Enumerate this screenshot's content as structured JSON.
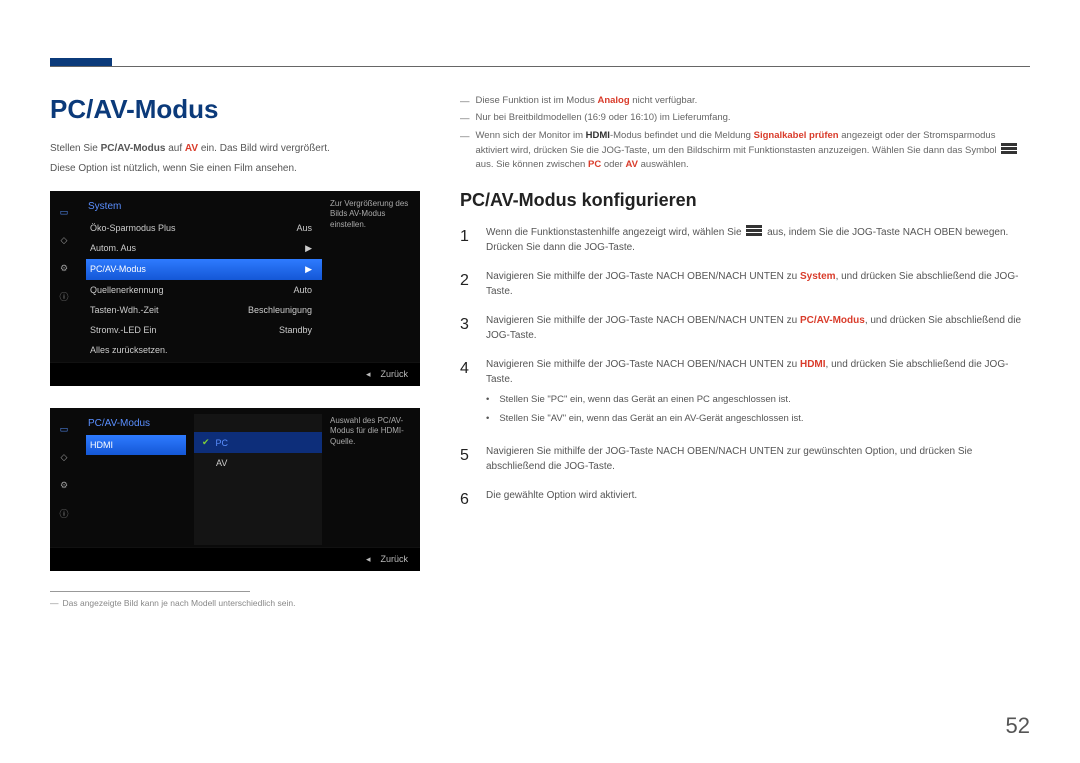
{
  "page_number": "52",
  "left": {
    "title": "PC/AV-Modus",
    "intro1_pre": "Stellen Sie ",
    "intro1_b1": "PC/AV-Modus",
    "intro1_mid": " auf ",
    "intro1_b2": "AV",
    "intro1_post": " ein. Das Bild wird vergrößert.",
    "intro2": "Diese Option ist nützlich, wenn Sie einen Film ansehen.",
    "osd1": {
      "title": "System",
      "rows": [
        {
          "label": "Öko-Sparmodus Plus",
          "value": "Aus"
        },
        {
          "label": "Autom. Aus",
          "value": "▶"
        },
        {
          "label": "PC/AV-Modus",
          "value": "▶",
          "hl": true
        },
        {
          "label": "Quellenerkennung",
          "value": "Auto"
        },
        {
          "label": "Tasten-Wdh.-Zeit",
          "value": "Beschleunigung"
        },
        {
          "label": "Stromv.-LED Ein",
          "value": "Standby"
        },
        {
          "label": "Alles zurücksetzen.",
          "value": ""
        }
      ],
      "desc": "Zur Vergrößerung des Bilds AV-Modus einstellen.",
      "footer": "Zurück"
    },
    "osd2": {
      "title": "PC/AV-Modus",
      "row_label": "HDMI",
      "sub": [
        {
          "label": "PC",
          "on": true
        },
        {
          "label": "AV",
          "on": false
        }
      ],
      "desc": "Auswahl des PC/AV-Modus für die HDMI-Quelle.",
      "footer": "Zurück"
    },
    "footnote": "Das angezeigte Bild kann je nach Modell unterschiedlich sein."
  },
  "right": {
    "notes": {
      "n1_pre": "Diese Funktion ist im Modus ",
      "n1_b": "Analog",
      "n1_post": " nicht verfügbar.",
      "n2": "Nur bei Breitbildmodellen (16:9 oder 16:10) im Lieferumfang.",
      "n3_pre": "Wenn sich der Monitor im ",
      "n3_b1": "HDMI",
      "n3_mid1": "-Modus befindet und die Meldung ",
      "n3_b2": "Signalkabel prüfen",
      "n3_mid2": " angezeigt oder der Stromsparmodus aktiviert wird, drücken Sie die JOG-Taste, um den Bildschirm mit Funktionstasten anzuzeigen. Wählen Sie dann das Symbol ",
      "n3_mid3": " aus. Sie können zwischen ",
      "n3_b3": "PC",
      "n3_or": " oder ",
      "n3_b4": "AV",
      "n3_post": " auswählen."
    },
    "h2": "PC/AV-Modus konfigurieren",
    "steps": {
      "s1a": "Wenn die Funktionstastenhilfe angezeigt wird, wählen Sie ",
      "s1b": " aus, indem Sie die JOG-Taste NACH OBEN bewegen.",
      "s1c": "Drücken Sie dann die JOG-Taste.",
      "s2a": "Navigieren Sie mithilfe der JOG-Taste NACH OBEN/NACH UNTEN zu ",
      "s2b": "System",
      "s2c": ", und drücken Sie abschließend die JOG-Taste.",
      "s3a": "Navigieren Sie mithilfe der JOG-Taste NACH OBEN/NACH UNTEN zu ",
      "s3b": "PC/AV-Modus",
      "s3c": ", und drücken Sie abschließend die JOG-Taste.",
      "s4a": "Navigieren Sie mithilfe der JOG-Taste NACH OBEN/NACH UNTEN zu ",
      "s4b": "HDMI",
      "s4c": ", und drücken Sie abschließend die JOG-Taste.",
      "s4_i1": "Stellen Sie \"PC\" ein, wenn das Gerät an einen PC angeschlossen ist.",
      "s4_i2": "Stellen Sie \"AV\" ein, wenn das Gerät an ein AV-Gerät angeschlossen ist.",
      "s5": "Navigieren Sie mithilfe der JOG-Taste NACH OBEN/NACH UNTEN zur gewünschten Option, und drücken Sie abschließend die JOG-Taste.",
      "s6": "Die gewählte Option wird aktiviert."
    }
  }
}
